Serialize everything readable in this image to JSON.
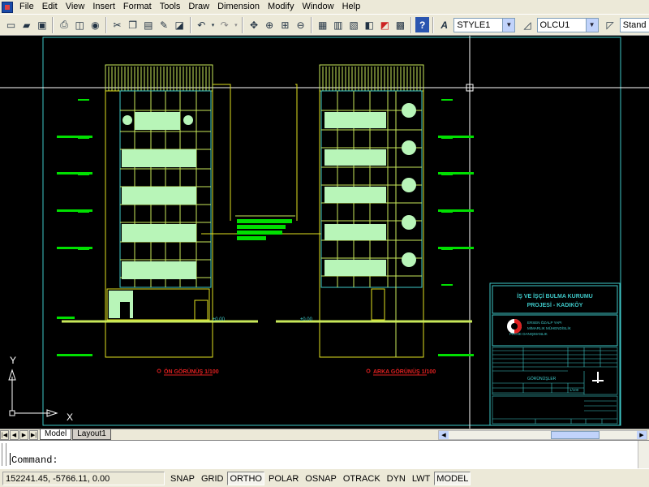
{
  "menu": {
    "items": [
      "File",
      "Edit",
      "View",
      "Insert",
      "Format",
      "Tools",
      "Draw",
      "Dimension",
      "Modify",
      "Window",
      "Help"
    ]
  },
  "toolbar": {
    "buttons": [
      "new-file-icon",
      "open-folder-icon",
      "save-icon",
      "print-icon",
      "plot-preview-icon",
      "publish-icon",
      "cut-icon",
      "copy-icon",
      "paste-icon",
      "match-properties-icon",
      "block-editor-icon",
      "undo-icon",
      "redo-icon",
      "pan-icon",
      "zoom-realtime-icon",
      "zoom-window-icon",
      "zoom-previous-icon",
      "properties-icon",
      "design-center-icon",
      "tool-palettes-icon",
      "sheet-set-icon",
      "markup-icon",
      "calculator-icon",
      "help-icon"
    ],
    "text_style": "STYLE1",
    "dim_style": "OLCU1",
    "third_style": "Stand"
  },
  "drawing": {
    "left_view_label": "ÖN GÖRÜNÜŞ 1/100",
    "right_view_label": "ARKA GÖRÜNÜŞ 1/100",
    "ground_label_left": "±0.00",
    "ground_label_right": "±0.00",
    "title_block": {
      "project_line1": "İŞ VE İŞÇİ BULMA KURUMU",
      "project_line2": "PROJESİ - KADIKÖY",
      "office_line1": "ERSEN ÖZALP YAPI",
      "office_line2": "MİMARLIK MÜHENDİSLİK",
      "office_line3": "PROJE DANIŞMANLIK",
      "sheet_title": "GÖRÜNÜŞLER",
      "scale": "1/100"
    },
    "ucs_x": "X",
    "ucs_y": "Y"
  },
  "tabs": {
    "model": "Model",
    "layout": "Layout1"
  },
  "command": {
    "prompt": "Command:"
  },
  "status": {
    "coords": "152241.45, -5766.11, 0.00",
    "buttons": [
      {
        "label": "SNAP",
        "on": false
      },
      {
        "label": "GRID",
        "on": false
      },
      {
        "label": "ORTHO",
        "on": true
      },
      {
        "label": "POLAR",
        "on": false
      },
      {
        "label": "OSNAP",
        "on": false
      },
      {
        "label": "OTRACK",
        "on": false
      },
      {
        "label": "DYN",
        "on": false
      },
      {
        "label": "LWT",
        "on": false
      },
      {
        "label": "MODEL",
        "on": true
      }
    ]
  },
  "colors": {
    "background": "#000000",
    "facade": "#c8e85a",
    "window_fill": "#b8f5b8",
    "cyan_frame": "#3ec8c8",
    "yellow_line": "#e0e020",
    "green_marker": "#00e000",
    "red_label": "#e02020"
  }
}
